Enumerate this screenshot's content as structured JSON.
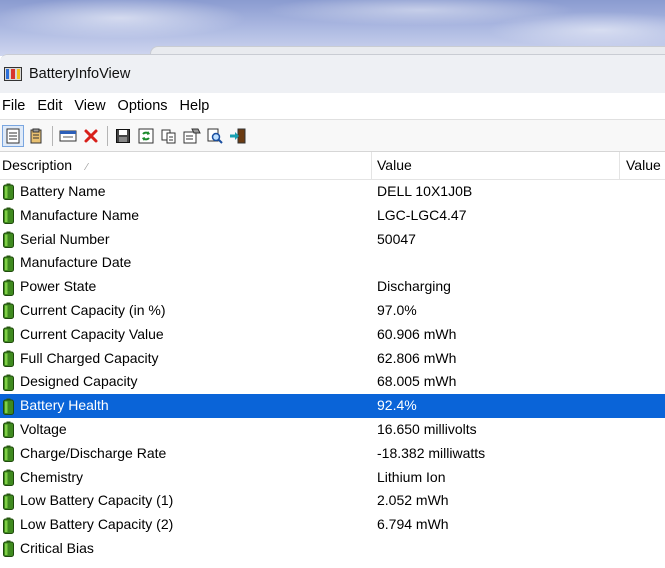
{
  "window": {
    "title": "BatteryInfoView"
  },
  "menu": [
    "File",
    "Edit",
    "View",
    "Options",
    "Help"
  ],
  "toolbar": [
    {
      "icon": "properties-view-icon",
      "active": true
    },
    {
      "icon": "clipboard-icon",
      "active": false
    },
    {
      "sep": true
    },
    {
      "icon": "window-icon",
      "active": false
    },
    {
      "icon": "delete-x-icon",
      "active": false
    },
    {
      "sep": true
    },
    {
      "icon": "save-icon",
      "active": false
    },
    {
      "icon": "refresh-icon",
      "active": false
    },
    {
      "icon": "copy-icon",
      "active": false
    },
    {
      "icon": "html-report-icon",
      "active": false
    },
    {
      "icon": "find-icon",
      "active": false
    },
    {
      "icon": "exit-icon",
      "active": false
    }
  ],
  "columns": {
    "description": "Description",
    "value": "Value",
    "value2": "Value"
  },
  "rows": [
    {
      "description": "Battery Name",
      "value": "DELL 10X1J0B"
    },
    {
      "description": "Manufacture Name",
      "value": "LGC-LGC4.47"
    },
    {
      "description": "Serial Number",
      "value": "50047"
    },
    {
      "description": "Manufacture Date",
      "value": ""
    },
    {
      "description": "Power State",
      "value": "Discharging"
    },
    {
      "description": "Current Capacity (in %)",
      "value": "97.0%"
    },
    {
      "description": "Current Capacity Value",
      "value": "60.906 mWh"
    },
    {
      "description": "Full Charged Capacity",
      "value": "62.806 mWh"
    },
    {
      "description": "Designed Capacity",
      "value": "68.005 mWh"
    },
    {
      "description": "Battery Health",
      "value": "92.4%",
      "selected": true
    },
    {
      "description": "Voltage",
      "value": "16.650 millivolts"
    },
    {
      "description": "Charge/Discharge Rate",
      "value": "-18.382 milliwatts"
    },
    {
      "description": "Chemistry",
      "value": "Lithium Ion"
    },
    {
      "description": "Low Battery Capacity (1)",
      "value": "2.052 mWh"
    },
    {
      "description": "Low Battery Capacity (2)",
      "value": "6.794 mWh"
    },
    {
      "description": "Critical Bias",
      "value": ""
    }
  ],
  "colors": {
    "selection": "#0a64d8",
    "battery_green": "#3f8a1f"
  }
}
